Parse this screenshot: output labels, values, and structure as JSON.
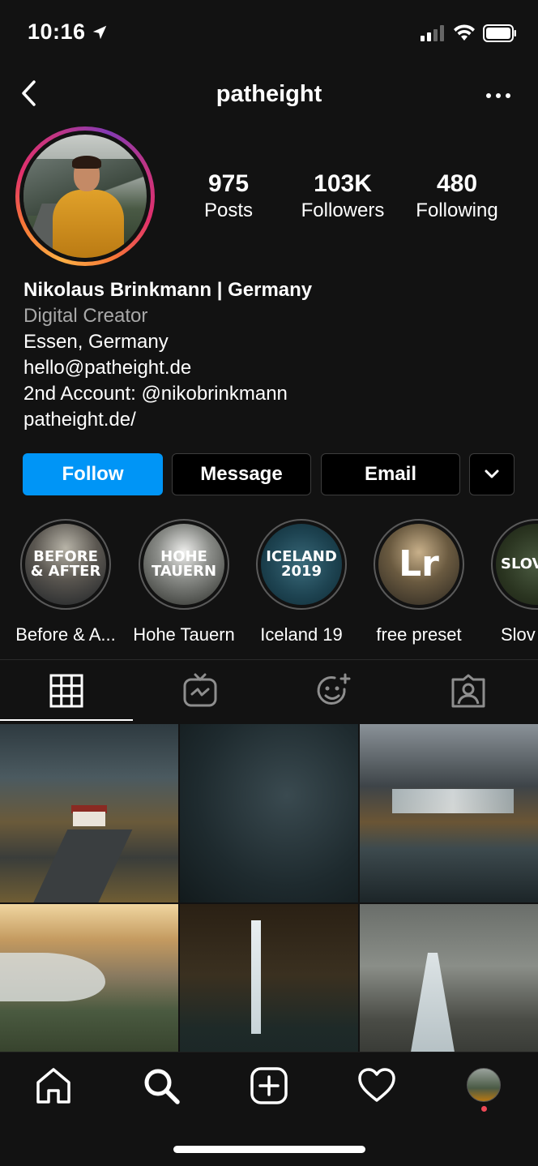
{
  "status_bar": {
    "time": "10:16"
  },
  "header": {
    "username": "patheight"
  },
  "profile": {
    "stats": [
      {
        "value": "975",
        "label": "Posts"
      },
      {
        "value": "103K",
        "label": "Followers"
      },
      {
        "value": "480",
        "label": "Following"
      }
    ],
    "name": "Nikolaus Brinkmann | Germany",
    "category": "Digital Creator",
    "location": "Essen, Germany",
    "email": "hello@patheight.de",
    "second_account": "2nd Account: @nikobrinkmann",
    "website": "patheight.de/"
  },
  "buttons": {
    "follow": "Follow",
    "message": "Message",
    "email": "Email"
  },
  "highlights": [
    {
      "cover_text": "BEFORE\n& AFTER",
      "label": "Before & A..."
    },
    {
      "cover_text": "HOHE\nTAUERN",
      "label": "Hohe Tauern"
    },
    {
      "cover_text": "ICELAND\n2019",
      "label": "Iceland 19"
    },
    {
      "cover_text": "Lr",
      "label": "free preset"
    },
    {
      "cover_text": "SLOV",
      "label": "Slov"
    }
  ],
  "tabs": [
    "grid-icon",
    "igtv-icon",
    "effects-icon",
    "tagged-icon"
  ],
  "bottom_nav": [
    "home-icon",
    "search-icon",
    "new-post-icon",
    "activity-heart-icon",
    "profile-avatar"
  ],
  "colors": {
    "accent": "#0095f6",
    "background": "#121212",
    "notification": "#ed4956"
  }
}
